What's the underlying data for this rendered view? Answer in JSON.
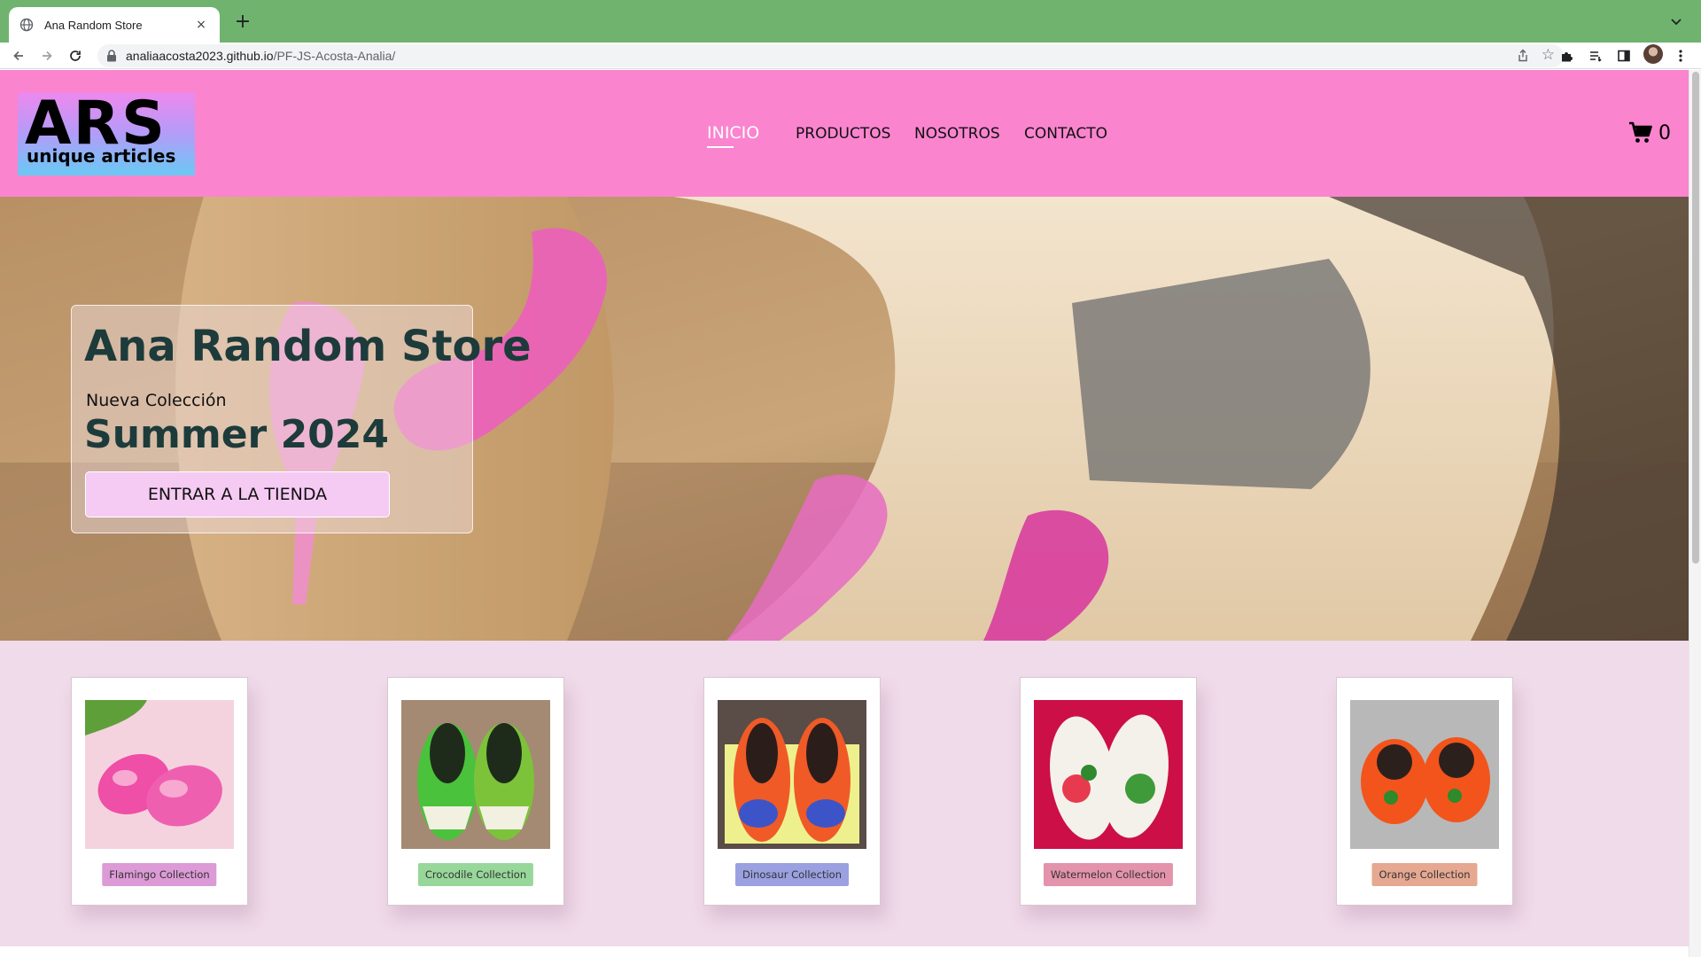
{
  "browser": {
    "tab_title": "Ana Random Store",
    "new_tab_label": "+",
    "close_label": "×",
    "url_host": "analiaacosta2023.github.io",
    "url_path": "/PF-JS-Acosta-Analia/"
  },
  "header": {
    "logo_main": "ARS",
    "logo_sub": "unique articles",
    "nav": [
      {
        "label": "INICIO",
        "active": true
      },
      {
        "label": "PRODUCTOS",
        "active": false
      },
      {
        "label": "NOSOTROS",
        "active": false
      },
      {
        "label": "CONTACTO",
        "active": false
      }
    ],
    "cart_count": "0"
  },
  "hero": {
    "title": "Ana Random Store",
    "subtitle": "Nueva Colección",
    "season": "Summer 2024",
    "button": "ENTRAR A LA TIENDA"
  },
  "collections": [
    {
      "label": "Flamingo Collection",
      "tag_color": "#dc9ad6",
      "image": "flamingo-clogs"
    },
    {
      "label": "Crocodile Collection",
      "tag_color": "#98d79a",
      "image": "crocodile-clogs"
    },
    {
      "label": "Dinosaur Collection",
      "tag_color": "#9aa0e0",
      "image": "dinosaur-clogs"
    },
    {
      "label": "Watermelon Collection",
      "tag_color": "#e493ad",
      "image": "watermelon-slides"
    },
    {
      "label": "Orange Collection",
      "tag_color": "#e6a891",
      "image": "orange-clogs"
    }
  ],
  "colors": {
    "tab_strip": "#6fb36f",
    "header": "#fb84cf",
    "collections_bg": "#f0dbea",
    "hero_button": "#f5caf3"
  }
}
